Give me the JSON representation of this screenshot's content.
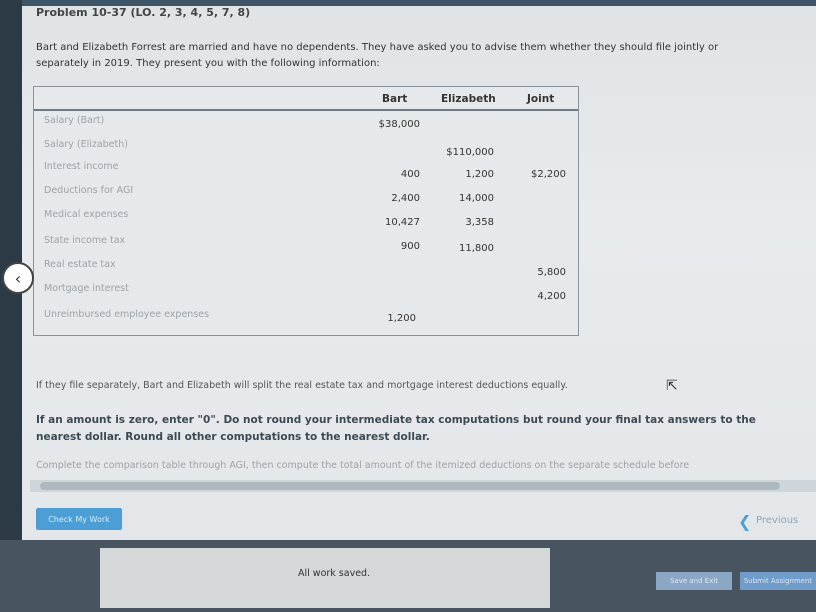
{
  "problem": {
    "title": "Problem 10-37 (LO. 2, 3, 4, 5, 7, 8)",
    "intro_line1": "Bart and Elizabeth Forrest are married and have no dependents. They have asked you to advise them whether they should file jointly or",
    "intro_line2": "separately in 2019. They present you with the following information:"
  },
  "table": {
    "headers": [
      "Bart",
      "Elizabeth",
      "Joint"
    ],
    "rows": [
      {
        "label": "Salary (Bart)",
        "bart": "$38,000",
        "elizabeth": "",
        "joint": ""
      },
      {
        "label": "Salary (Elizabeth)",
        "bart": "",
        "elizabeth": "$110,000",
        "joint": ""
      },
      {
        "label": "Interest income",
        "bart": "400",
        "elizabeth": "1,200",
        "joint": "$2,200"
      },
      {
        "label": "Deductions for AGI",
        "bart": "2,400",
        "elizabeth": "14,000",
        "joint": ""
      },
      {
        "label": "Medical expenses",
        "bart": "10,427",
        "elizabeth": "3,358",
        "joint": ""
      },
      {
        "label": "State income tax",
        "bart": "900",
        "elizabeth": "11,800",
        "joint": ""
      },
      {
        "label": "Real estate tax",
        "bart": "",
        "elizabeth": "",
        "joint": "5,800"
      },
      {
        "label": "Mortgage interest",
        "bart": "",
        "elizabeth": "",
        "joint": "4,200"
      },
      {
        "label": "Unreimbursed employee expenses",
        "bart": "1,200",
        "elizabeth": "",
        "joint": ""
      }
    ]
  },
  "notes": {
    "separate": "If they file separately, Bart and Elizabeth will split the real estate tax and mortgage interest deductions equally.",
    "instruction": "If an amount is zero, enter \"0\". Do not round your intermediate tax computations but round your final tax answers to the nearest dollar. Round all other computations to the nearest dollar.",
    "complete": "Complete the comparison table through AGI, then compute the total amount of the itemized deductions on the separate schedule before"
  },
  "buttons": {
    "check_my_work": "Check My Work",
    "previous": "Previous",
    "save_and_exit": "Save and Exit",
    "submit": "Submit Assignment"
  },
  "status": {
    "saved": "All work saved."
  },
  "icons": {
    "back": "chevron-left-icon",
    "previous": "chevron-left-icon",
    "cursor": "mouse-pointer-icon"
  }
}
